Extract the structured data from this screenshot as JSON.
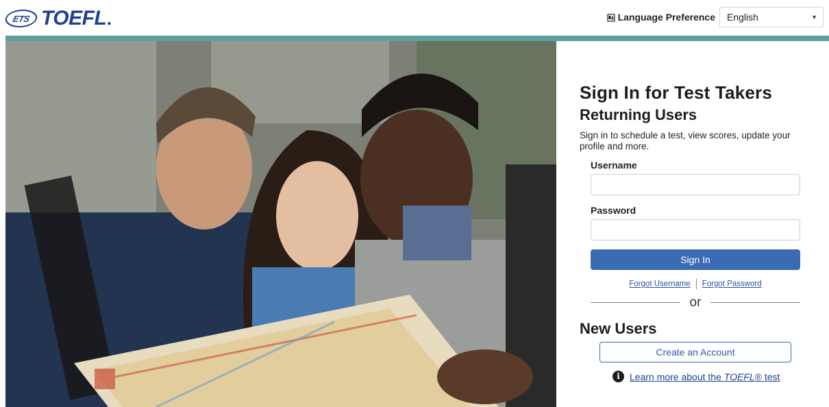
{
  "header": {
    "logo_ets": "ETS",
    "logo_toefl": "TOEFL",
    "language_label": "Language Preference",
    "language_selected": "English"
  },
  "signin": {
    "title": "Sign In for Test Takers",
    "subtitle": "Returning Users",
    "description": "Sign in to schedule a test, view scores, update your profile and more.",
    "username_label": "Username",
    "username_value": "",
    "password_label": "Password",
    "password_value": "",
    "signin_button": "Sign In",
    "forgot_username": "Forgot Username",
    "forgot_password": "Forgot Password",
    "or_text": "or"
  },
  "newusers": {
    "heading": "New Users",
    "create_button": "Create an Account",
    "learn_prefix": "Learn more about the ",
    "learn_em": "TOEFL",
    "learn_suffix": "® test"
  },
  "colors": {
    "brand_blue": "#1f3f8f",
    "button_blue": "#3c6bb6",
    "teal_bar": "#5e9f9f"
  },
  "icons": {
    "language": "language-flag-icon",
    "dropdown": "chevron-down-icon",
    "info": "info-circle-icon"
  }
}
